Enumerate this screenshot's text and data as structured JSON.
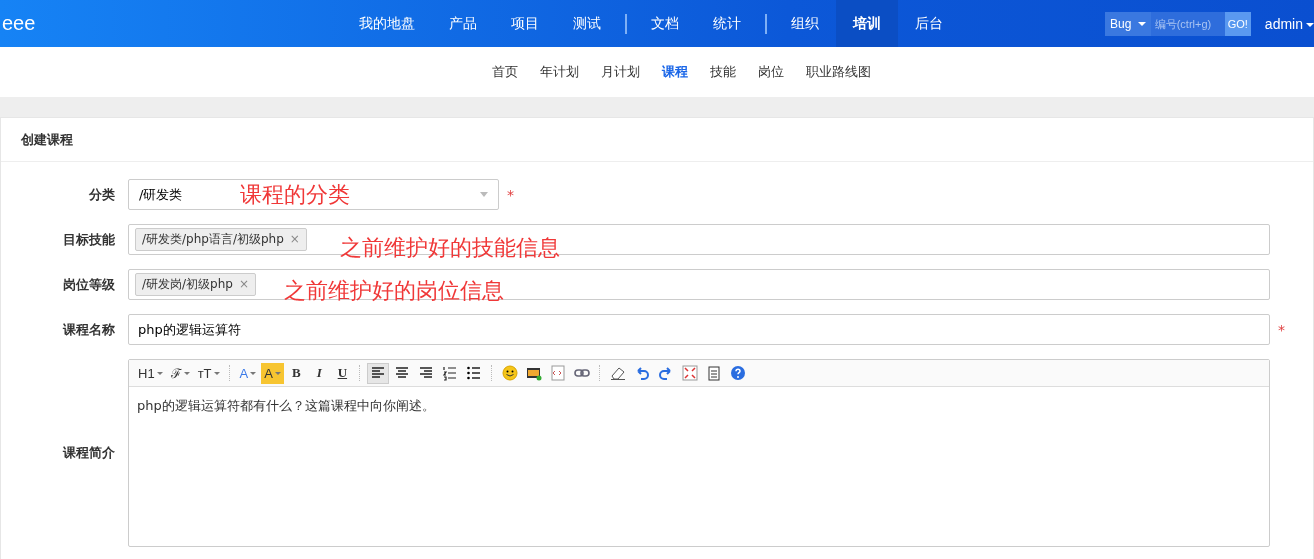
{
  "brand": "eee",
  "main_nav": [
    [
      {
        "label": "我的地盘",
        "selected": false
      },
      {
        "label": "产品",
        "selected": false
      },
      {
        "label": "项目",
        "selected": false
      },
      {
        "label": "测试",
        "selected": false
      }
    ],
    [
      {
        "label": "文档",
        "selected": false
      },
      {
        "label": "统计",
        "selected": false
      }
    ],
    [
      {
        "label": "组织",
        "selected": false
      },
      {
        "label": "培训",
        "selected": true
      },
      {
        "label": "后台",
        "selected": false
      }
    ]
  ],
  "quick_search": {
    "type": "Bug",
    "placeholder": "编号(ctrl+g)",
    "button": "GO!"
  },
  "user": "admin",
  "sub_nav": [
    {
      "label": "首页",
      "selected": false
    },
    {
      "label": "年计划",
      "selected": false
    },
    {
      "label": "月计划",
      "selected": false
    },
    {
      "label": "课程",
      "selected": true
    },
    {
      "label": "技能",
      "selected": false
    },
    {
      "label": "岗位",
      "selected": false
    },
    {
      "label": "职业路线图",
      "selected": false
    }
  ],
  "form": {
    "title": "创建课程",
    "fields": [
      {
        "kind": "select",
        "label": "分类",
        "value": "/研发类",
        "required_mark": "*",
        "annotation": "课程的分类"
      },
      {
        "kind": "tags",
        "label": "目标技能",
        "tags": [
          {
            "label": "/研发类/php语言/初级php",
            "remove": "×"
          }
        ],
        "annotation": "之前维护好的技能信息"
      },
      {
        "kind": "tags",
        "label": "岗位等级",
        "tags": [
          {
            "label": "/研发岗/初级php",
            "remove": "×"
          }
        ],
        "annotation": "之前维护好的岗位信息"
      },
      {
        "kind": "text",
        "label": "课程名称",
        "value": "php的逻辑运算符",
        "required_mark": "*"
      },
      {
        "kind": "editor",
        "label": "课程简介",
        "value": "php的逻辑运算符都有什么？这篇课程中向你阐述。"
      }
    ],
    "toolbar": [
      [
        {
          "kind": "text",
          "label": "H1",
          "dropdown": true,
          "selected": false
        },
        {
          "kind": "text",
          "label": "ℱ",
          "dropdown": true,
          "selected": false
        },
        {
          "kind": "text",
          "label": "ᴛT",
          "dropdown": true,
          "selected": false
        }
      ],
      [
        {
          "kind": "color",
          "label": "A",
          "dropdown": true,
          "selected": false
        },
        {
          "kind": "highlight",
          "label": "A",
          "dropdown": true,
          "selected": false
        },
        {
          "kind": "bold",
          "label": "B",
          "dropdown": false,
          "selected": false
        },
        {
          "kind": "italic",
          "label": "I",
          "dropdown": false,
          "selected": false
        },
        {
          "kind": "underline",
          "label": "U",
          "dropdown": false,
          "selected": false
        }
      ],
      [
        {
          "kind": "align-left",
          "selected": true
        },
        {
          "kind": "align-center",
          "selected": false
        },
        {
          "kind": "align-right",
          "selected": false
        },
        {
          "kind": "ordered-list",
          "selected": false
        },
        {
          "kind": "bullet-list",
          "selected": false
        }
      ],
      [
        {
          "kind": "emoji",
          "selected": false
        },
        {
          "kind": "image",
          "selected": false
        },
        {
          "kind": "code",
          "selected": false
        },
        {
          "kind": "link",
          "selected": false
        }
      ],
      [
        {
          "kind": "eraser",
          "selected": false
        },
        {
          "kind": "undo",
          "selected": false
        },
        {
          "kind": "redo",
          "selected": false
        },
        {
          "kind": "fullscreen",
          "selected": false
        },
        {
          "kind": "paste",
          "selected": false
        },
        {
          "kind": "help",
          "selected": false
        }
      ]
    ]
  }
}
